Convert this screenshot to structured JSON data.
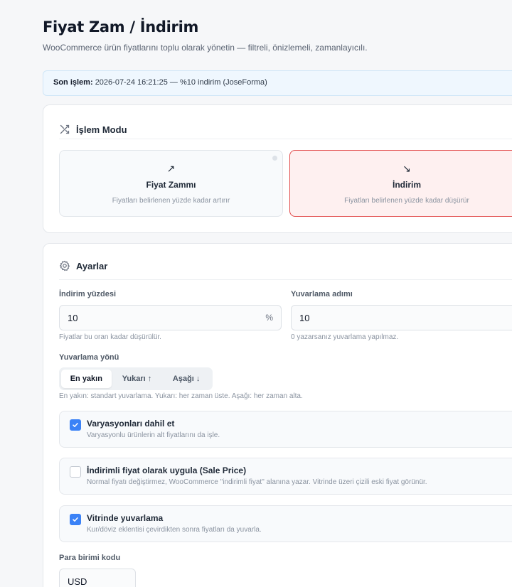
{
  "header": {
    "title": "Fiyat Zam / İndirim",
    "subtitle": "WooCommerce ürün fiyatlarını toplu olarak yönetin — filtreli, önizlemeli, zamanlayıcılı."
  },
  "last_operation": {
    "label": "Son işlem:",
    "value": "2026-07-24 16:21:25 — %10 indirim (JoseForma)"
  },
  "mode_card": {
    "title": "İşlem Modu",
    "icon": "shuffle-icon",
    "options": [
      {
        "arrow": "↗",
        "title": "Fiyat Zammı",
        "desc": "Fiyatları belirlenen yüzde kadar artırır",
        "selected": false
      },
      {
        "arrow": "↘",
        "title": "İndirim",
        "desc": "Fiyatları belirlenen yüzde kadar düşürür",
        "selected": true
      }
    ]
  },
  "settings_card": {
    "title": "Ayarlar",
    "icon": "gear-icon",
    "percent": {
      "label": "İndirim yüzdesi",
      "value": "10",
      "suffix": "%",
      "hint": "Fiyatlar bu oran kadar düşürülür."
    },
    "rounding_step": {
      "label": "Yuvarlama adımı",
      "value": "10",
      "hint": "0 yazarsanız yuvarlama yapılmaz."
    },
    "rounding_direction": {
      "label": "Yuvarlama yönü",
      "options": [
        "En yakın",
        "Yukarı ↑",
        "Aşağı ↓"
      ],
      "selected": "En yakın",
      "hint": "En yakın: standart yuvarlama. Yukarı: her zaman üste. Aşağı: her zaman alta."
    },
    "checkboxes": [
      {
        "title": "Varyasyonları dahil et",
        "desc": "Varyasyonlu ürünlerin alt fiyatlarını da işle.",
        "checked": true
      },
      {
        "title": "İndirimli fiyat olarak uygula (Sale Price)",
        "desc": "Normal fiyatı değiştirmez, WooCommerce \"indirimli fiyat\" alanına yazar. Vitrinde üzeri çizili eski fiyat görünür.",
        "checked": false
      },
      {
        "title": "Vitrinde yuvarlama",
        "desc": "Kur/döviz eklentisi çevirdikten sonra fiyatları da yuvarla.",
        "checked": true
      }
    ],
    "currency": {
      "label": "Para birimi kodu",
      "value": "USD"
    }
  },
  "colors": {
    "accent": "#3b82f6",
    "danger": "#e24b4b",
    "info_bg": "#eff7fe"
  }
}
